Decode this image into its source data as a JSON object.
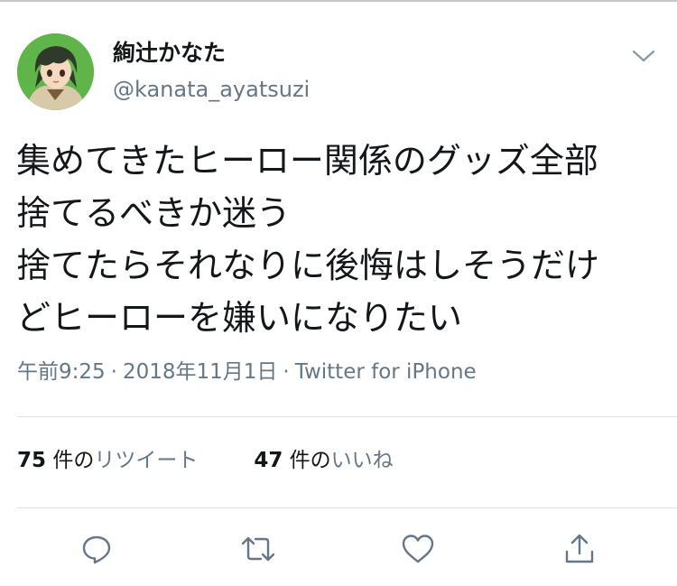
{
  "user": {
    "display_name": "絢辻かなた",
    "handle": "@kanata_ayatsuzi",
    "avatar_icon": "anime-character-avatar"
  },
  "tweet": {
    "text": "集めてきたヒーロー関係のグッズ全部\n捨てるべきか迷う\n捨てたらそれなりに後悔はしそうだけ\nどヒーローを嫌いになりたい",
    "time": "午前9:25",
    "date": "2018年11月1日",
    "separator": "·",
    "source": "Twitter for iPhone"
  },
  "stats": {
    "retweets": {
      "count": "75",
      "unit": "件の",
      "label": "リツイート"
    },
    "likes": {
      "count": "47",
      "unit": "件の",
      "label": "いいね"
    }
  },
  "actions": {
    "reply_icon": "reply-icon",
    "retweet_icon": "retweet-icon",
    "like_icon": "heart-icon",
    "share_icon": "share-icon"
  },
  "colors": {
    "text_primary": "#14171a",
    "text_secondary": "#657786",
    "divider": "#dfe3e6"
  }
}
